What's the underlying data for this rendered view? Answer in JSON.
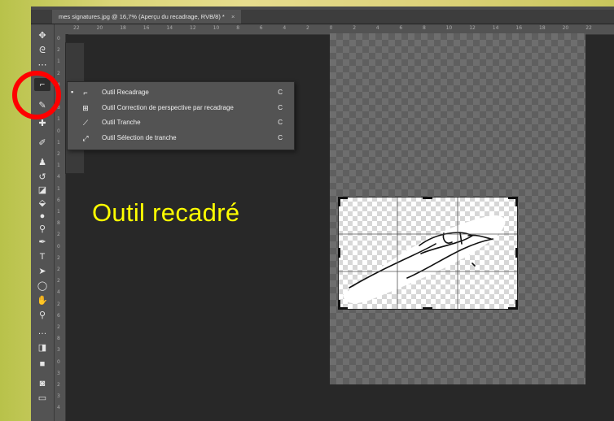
{
  "document": {
    "tab_title": "mes signatures.jpg @ 16,7% (Aperçu du recadrage, RVB/8) *",
    "tab_close": "×"
  },
  "ruler": {
    "horizontal": [
      "22",
      "20",
      "18",
      "16",
      "14",
      "12",
      "10",
      "8",
      "6",
      "4",
      "2",
      "0",
      "2",
      "4",
      "6",
      "8",
      "10",
      "12",
      "14",
      "16",
      "18",
      "20",
      "22"
    ],
    "vertical": [
      "0",
      "2",
      "1",
      "2",
      "4",
      "6",
      "8",
      "1",
      "0",
      "1",
      "2",
      "1",
      "4",
      "1",
      "6",
      "1",
      "8",
      "2",
      "0",
      "2",
      "2",
      "2",
      "4",
      "2",
      "6",
      "2",
      "8",
      "3",
      "0",
      "3",
      "2",
      "3",
      "4"
    ]
  },
  "toolbar": {
    "tools": [
      {
        "name": "move-tool",
        "glyph": "✥"
      },
      {
        "name": "lasso-tool",
        "glyph": "ᘓ"
      },
      {
        "name": "quick-selection-tool",
        "glyph": "⋯"
      },
      {
        "name": "crop-tool",
        "glyph": "⌐",
        "active": true
      },
      {
        "name": "eyedropper-tool",
        "glyph": "✎"
      },
      {
        "name": "healing-brush-tool",
        "glyph": "✚"
      },
      {
        "name": "brush-tool",
        "glyph": "✐"
      },
      {
        "name": "clone-stamp-tool",
        "glyph": "♟"
      },
      {
        "name": "history-brush-tool",
        "glyph": "↺"
      },
      {
        "name": "eraser-tool",
        "glyph": "◪"
      },
      {
        "name": "paint-bucket-tool",
        "glyph": "⬙"
      },
      {
        "name": "blur-tool",
        "glyph": "●"
      },
      {
        "name": "dodge-tool",
        "glyph": "⚲"
      },
      {
        "name": "pen-tool",
        "glyph": "✒"
      },
      {
        "name": "type-tool",
        "glyph": "T"
      },
      {
        "name": "path-selection-tool",
        "glyph": "➤"
      },
      {
        "name": "ellipse-tool",
        "glyph": "◯"
      },
      {
        "name": "hand-tool",
        "glyph": "✋"
      },
      {
        "name": "zoom-tool",
        "glyph": "⚲"
      },
      {
        "name": "more-tools",
        "glyph": "…"
      },
      {
        "name": "default-colors",
        "glyph": "◨"
      },
      {
        "name": "color-swatches",
        "glyph": "■"
      },
      {
        "name": "quick-mask-mode",
        "glyph": "◙"
      },
      {
        "name": "screen-mode",
        "glyph": "▭"
      }
    ]
  },
  "flyout": {
    "items": [
      {
        "icon": "crop-icon",
        "glyph": "⌐",
        "label": "Outil Recadrage",
        "shortcut": "C",
        "selected": true
      },
      {
        "icon": "perspective-crop-icon",
        "glyph": "⊞",
        "label": "Outil Correction de perspective par recadrage",
        "shortcut": "C"
      },
      {
        "icon": "slice-icon",
        "glyph": "⟋",
        "label": "Outil Tranche",
        "shortcut": "C"
      },
      {
        "icon": "slice-select-icon",
        "glyph": "⤢",
        "label": "Outil Sélection de tranche",
        "shortcut": "C"
      }
    ]
  },
  "annotation": {
    "label": "Outil recadré",
    "label_color": "#ffff00",
    "circle_color": "#ff0000"
  },
  "colors": {
    "workspace": "#282828",
    "panel": "#535353",
    "canvas_checker": "#6e6e6e"
  }
}
